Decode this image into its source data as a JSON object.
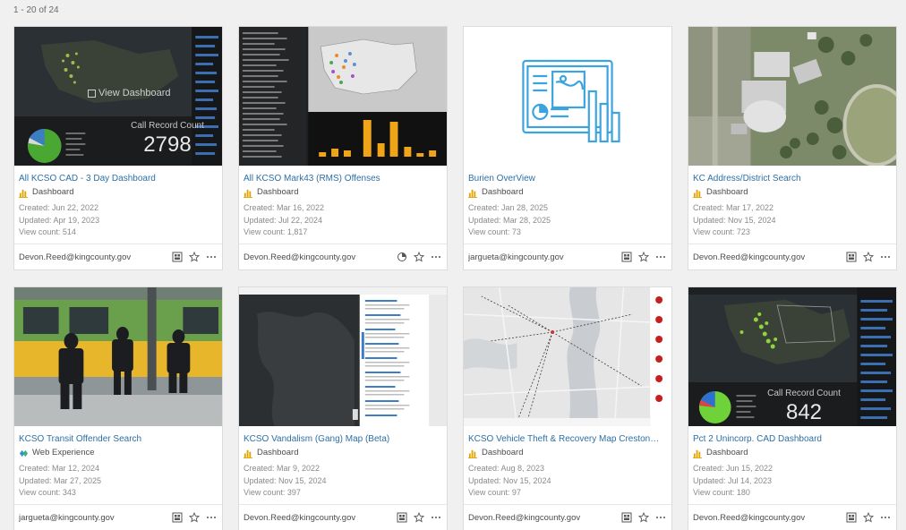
{
  "results": {
    "range_label": "1 - 20 of 24"
  },
  "thumb_overlays": {
    "view_dashboard": "View Dashboard",
    "call_record_label": "Call Record Count",
    "card1_count": "2798",
    "card8_count": "842"
  },
  "cards": [
    {
      "title": "All KCSO CAD - 3 Day Dashboard",
      "type": "Dashboard",
      "created": "Created: Jun 22, 2022",
      "updated": "Updated: Apr 19, 2023",
      "views": "View count: 514",
      "owner": "Devon.Reed@kingcounty.gov"
    },
    {
      "title": "All KCSO Mark43 (RMS) Offenses",
      "type": "Dashboard",
      "created": "Created: Mar 16, 2022",
      "updated": "Updated: Jul 22, 2024",
      "views": "View count: 1,817",
      "owner": "Devon.Reed@kingcounty.gov"
    },
    {
      "title": "Burien OverView",
      "type": "Dashboard",
      "created": "Created: Jan 28, 2025",
      "updated": "Updated: Mar 28, 2025",
      "views": "View count: 73",
      "owner": "jargueta@kingcounty.gov"
    },
    {
      "title": "KC Address/District Search",
      "type": "Dashboard",
      "created": "Created: Mar 17, 2022",
      "updated": "Updated: Nov 15, 2024",
      "views": "View count: 723",
      "owner": "Devon.Reed@kingcounty.gov"
    },
    {
      "title": "KCSO Transit Offender Search",
      "type": "Web Experience",
      "created": "Created: Mar 12, 2024",
      "updated": "Updated: Mar 27, 2025",
      "views": "View count: 343",
      "owner": "jargueta@kingcounty.gov"
    },
    {
      "title": "KCSO Vandalism (Gang) Map (Beta)",
      "type": "Dashboard",
      "created": "Created: Mar 9, 2022",
      "updated": "Updated: Nov 15, 2024",
      "views": "View count: 397",
      "owner": "Devon.Reed@kingcounty.gov"
    },
    {
      "title": "KCSO Vehicle Theft & Recovery Map Creston…",
      "type": "Dashboard",
      "created": "Created: Aug 8, 2023",
      "updated": "Updated: Nov 15, 2024",
      "views": "View count: 97",
      "owner": "Devon.Reed@kingcounty.gov"
    },
    {
      "title": "Pct 2 Unincorp. CAD Dashboard",
      "type": "Dashboard",
      "created": "Created: Jun 15, 2022",
      "updated": "Updated: Jul 14, 2023",
      "views": "View count: 180",
      "owner": "Devon.Reed@kingcounty.gov"
    }
  ],
  "icons": {
    "dashboard_type": "dashboard-bar-icon",
    "web_experience_type": "web-experience-icon",
    "share": "share-grid-icon",
    "shared_org": "shared-org-icon",
    "favorite": "star-outline-icon",
    "more": "more-ellipsis-icon"
  },
  "colors": {
    "link": "#2d6fa4",
    "dashboard_icon": "#e0a500",
    "accent_blue": "#3ba3dd"
  }
}
